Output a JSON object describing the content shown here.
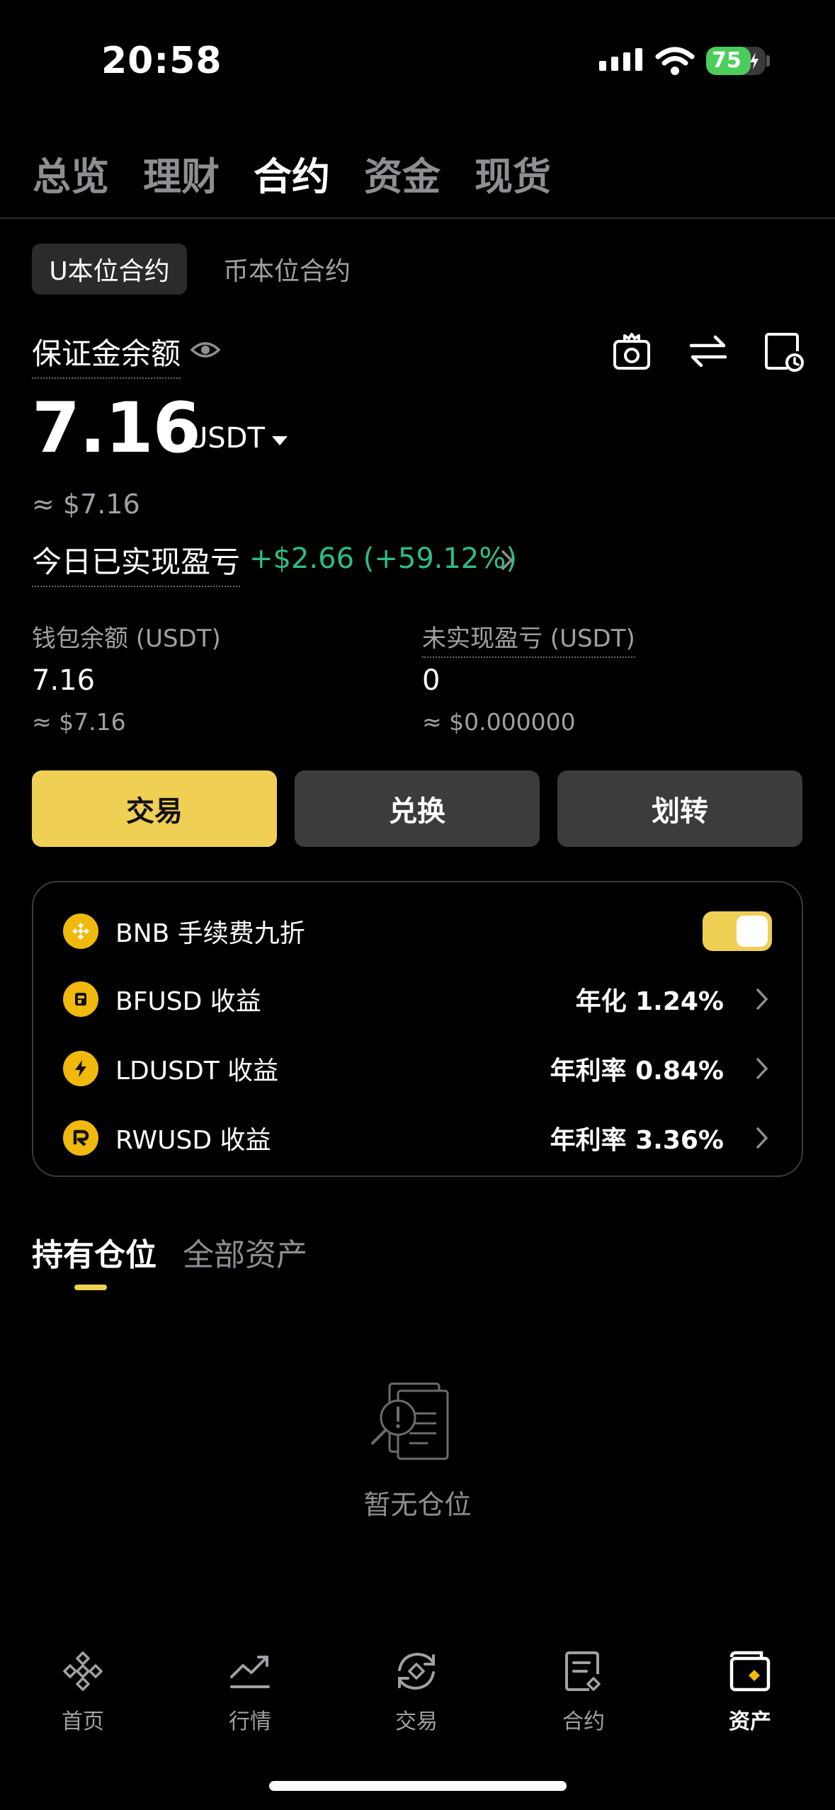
{
  "status_bar": {
    "time": "20:58",
    "battery": "75",
    "battery_percent": 75
  },
  "top_tabs": [
    {
      "label": "总览",
      "active": false
    },
    {
      "label": "理财",
      "active": false
    },
    {
      "label": "合约",
      "active": true
    },
    {
      "label": "资金",
      "active": false
    },
    {
      "label": "现货",
      "active": false
    }
  ],
  "sub_tabs": {
    "active": "U本位合约",
    "inactive": "币本位合约"
  },
  "margin": {
    "label": "保证金余额",
    "value": "7.16",
    "unit": "USDT",
    "approx": "≈ $7.16",
    "pnl_label": "今日已实现盈亏",
    "pnl_value": "+$2.66 (+59.12%)"
  },
  "wallet": {
    "label": "钱包余额 (USDT)",
    "value": "7.16",
    "approx": "≈ $7.16"
  },
  "unrealized": {
    "label": "未实现盈亏 (USDT)",
    "value": "0",
    "approx": "≈ $0.000000"
  },
  "buttons": {
    "trade": "交易",
    "convert": "兑换",
    "transfer": "划转"
  },
  "card": {
    "bnb": {
      "label": "BNB 手续费九折",
      "enabled": true
    },
    "rows": [
      {
        "label": "BFUSD 收益",
        "value": "年化 1.24%",
        "icon": "bfusd-coin-icon"
      },
      {
        "label": "LDUSDT 收益",
        "value": "年利率 0.84%",
        "icon": "ldusdt-coin-icon"
      },
      {
        "label": "RWUSD 收益",
        "value": "年利率 3.36%",
        "icon": "rwusd-coin-icon"
      }
    ]
  },
  "positions": {
    "tab_active": "持有仓位",
    "tab_inactive": "全部资产",
    "empty_text": "暂无仓位"
  },
  "bottom_nav": [
    {
      "label": "首页",
      "icon": "home-icon",
      "active": false
    },
    {
      "label": "行情",
      "icon": "markets-icon",
      "active": false
    },
    {
      "label": "交易",
      "icon": "trade-icon",
      "active": false
    },
    {
      "label": "合约",
      "icon": "futures-icon",
      "active": false
    },
    {
      "label": "资产",
      "icon": "assets-icon",
      "active": true
    }
  ],
  "colors": {
    "accent": "#f0cf55",
    "profit": "#2ebd85",
    "coin": "#f0b90b",
    "background": "#000000"
  }
}
